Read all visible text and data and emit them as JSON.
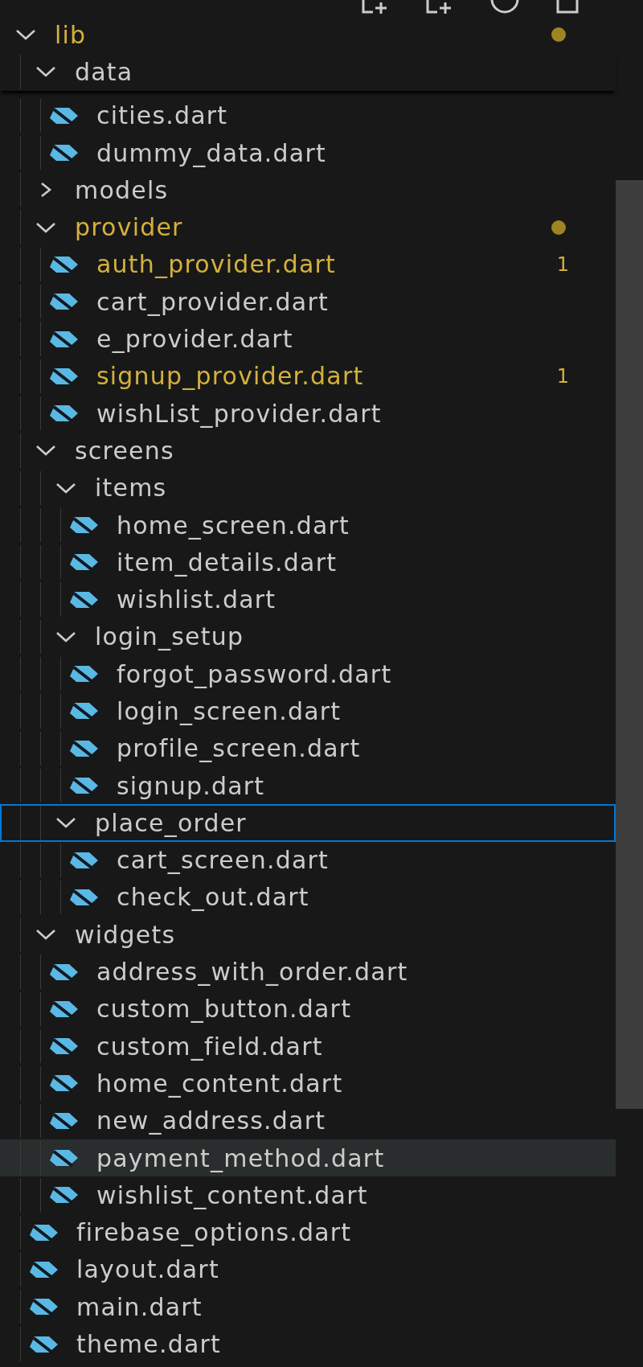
{
  "explorer": {
    "toolbar": [
      {
        "kind": "new-file"
      },
      {
        "kind": "new-folder"
      },
      {
        "kind": "refresh"
      },
      {
        "kind": "collapse"
      }
    ],
    "tree": [
      {
        "name": "lib",
        "kind": "folder",
        "expanded": true,
        "modified": true,
        "children": [
          {
            "name": "data",
            "kind": "folder",
            "expanded": true,
            "modified": false,
            "children": [
              {
                "name": "cities.dart",
                "kind": "file",
                "modified": false
              },
              {
                "name": "dummy_data.dart",
                "kind": "file",
                "modified": false
              }
            ]
          },
          {
            "name": "models",
            "kind": "folder",
            "expanded": false,
            "modified": false
          },
          {
            "name": "provider",
            "kind": "folder",
            "expanded": true,
            "modified": true,
            "children": [
              {
                "name": "auth_provider.dart",
                "kind": "file",
                "modified": true,
                "problems": "1"
              },
              {
                "name": "cart_provider.dart",
                "kind": "file",
                "modified": false
              },
              {
                "name": "e_provider.dart",
                "kind": "file",
                "modified": false
              },
              {
                "name": "signup_provider.dart",
                "kind": "file",
                "modified": true,
                "problems": "1"
              },
              {
                "name": "wishList_provider.dart",
                "kind": "file",
                "modified": false
              }
            ]
          },
          {
            "name": "screens",
            "kind": "folder",
            "expanded": true,
            "modified": false,
            "children": [
              {
                "name": "items",
                "kind": "folder",
                "expanded": true,
                "modified": false,
                "children": [
                  {
                    "name": "home_screen.dart",
                    "kind": "file",
                    "modified": false
                  },
                  {
                    "name": "item_details.dart",
                    "kind": "file",
                    "modified": false
                  },
                  {
                    "name": "wishlist.dart",
                    "kind": "file",
                    "modified": false
                  }
                ]
              },
              {
                "name": "login_setup",
                "kind": "folder",
                "expanded": true,
                "modified": false,
                "children": [
                  {
                    "name": "forgot_password.dart",
                    "kind": "file",
                    "modified": false
                  },
                  {
                    "name": "login_screen.dart",
                    "kind": "file",
                    "modified": false
                  },
                  {
                    "name": "profile_screen.dart",
                    "kind": "file",
                    "modified": false
                  },
                  {
                    "name": "signup.dart",
                    "kind": "file",
                    "modified": false
                  }
                ]
              },
              {
                "name": "place_order",
                "kind": "folder",
                "expanded": true,
                "modified": false,
                "selected": true,
                "children": [
                  {
                    "name": "cart_screen.dart",
                    "kind": "file",
                    "modified": false
                  },
                  {
                    "name": "check_out.dart",
                    "kind": "file",
                    "modified": false
                  }
                ]
              }
            ]
          },
          {
            "name": "widgets",
            "kind": "folder",
            "expanded": true,
            "modified": false,
            "children": [
              {
                "name": "address_with_order.dart",
                "kind": "file",
                "modified": false
              },
              {
                "name": "custom_button.dart",
                "kind": "file",
                "modified": false
              },
              {
                "name": "custom_field.dart",
                "kind": "file",
                "modified": false
              },
              {
                "name": "home_content.dart",
                "kind": "file",
                "modified": false
              },
              {
                "name": "new_address.dart",
                "kind": "file",
                "modified": false
              },
              {
                "name": "payment_method.dart",
                "kind": "file",
                "modified": false,
                "hovered": true
              },
              {
                "name": "wishlist_content.dart",
                "kind": "file",
                "modified": false
              }
            ]
          },
          {
            "name": "firebase_options.dart",
            "kind": "file",
            "modified": false
          },
          {
            "name": "layout.dart",
            "kind": "file",
            "modified": false
          },
          {
            "name": "main.dart",
            "kind": "file",
            "modified": false
          },
          {
            "name": "theme.dart",
            "kind": "file",
            "modified": false
          }
        ]
      }
    ]
  }
}
